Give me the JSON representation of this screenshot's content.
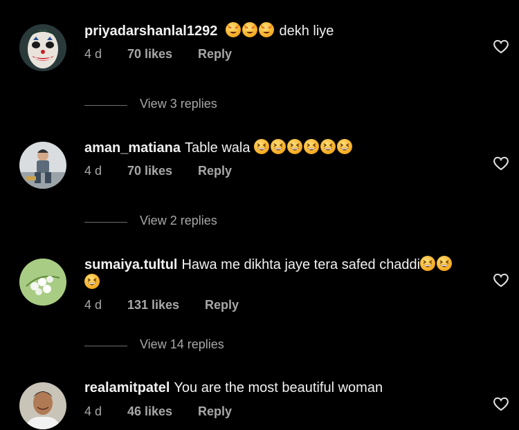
{
  "comments": [
    {
      "username": "priyadarshanlal1292",
      "emojis": [
        "heart-eyes-cat",
        "heart-eyes-cat",
        "heart-eyes-cat"
      ],
      "text_after": "dekh liye",
      "text": "",
      "time": "4 d",
      "likes": "70 likes",
      "reply": "Reply",
      "view_replies": "View 3 replies",
      "avatar": "joker-face"
    },
    {
      "username": "aman_matiana",
      "text": "Table wala",
      "emojis": [
        "grinning-squinting-face",
        "grinning-squinting-face",
        "grinning-squinting-face",
        "grinning-squinting-face",
        "grinning-squinting-face",
        "grinning-squinting-face"
      ],
      "time": "4 d",
      "likes": "70 likes",
      "reply": "Reply",
      "view_replies": "View 2 replies",
      "avatar": "child-photo"
    },
    {
      "username": "sumaiya.tultul",
      "text": "Hawa me dikhta jaye tera safed chaddi",
      "emojis": [
        "grinning-squinting-face",
        "grinning-squinting-face",
        "grinning-squinting-face"
      ],
      "time": "4 d",
      "likes": "131 likes",
      "reply": "Reply",
      "view_replies": "View 14 replies",
      "avatar": "flower-photo"
    },
    {
      "username": "realamitpatel",
      "text": "You are the most beautiful woman",
      "emojis": [],
      "time": "4 d",
      "likes": "46 likes",
      "reply": "Reply",
      "avatar": "man-photo"
    }
  ],
  "colors": {
    "background": "#000000",
    "text": "#f2f2f2",
    "meta": "#a8a8a8",
    "divider": "#6f6f6f"
  },
  "icons": {
    "like": "heart-outline-icon"
  }
}
